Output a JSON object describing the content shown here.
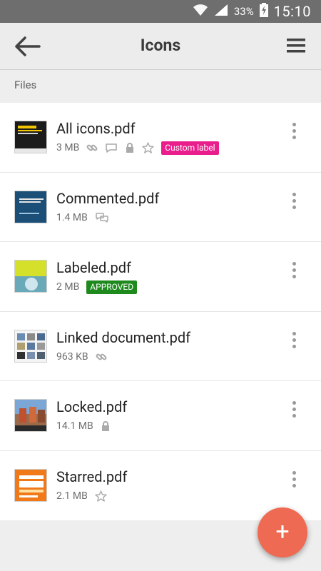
{
  "status_bar": {
    "battery_percent": "33%",
    "time": "15:10"
  },
  "app_bar": {
    "title": "Icons",
    "back_icon": "arrow-left-icon",
    "menu_icon": "hamburger-menu-icon"
  },
  "section": {
    "label": "Files"
  },
  "files": [
    {
      "name": "All icons.pdf",
      "size": "3 MB",
      "icons": [
        "link-icon",
        "comment-icon",
        "lock-icon",
        "star-icon"
      ],
      "label": {
        "text": "Custom label",
        "color": "#e91e8c"
      }
    },
    {
      "name": "Commented.pdf",
      "size": "1.4 MB",
      "icons": [
        "comment-icon"
      ]
    },
    {
      "name": "Labeled.pdf",
      "size": "2 MB",
      "icons": [],
      "label": {
        "text": "APPROVED",
        "color": "#1e8a1e"
      }
    },
    {
      "name": "Linked document.pdf",
      "size": "963 KB",
      "icons": [
        "link-icon"
      ]
    },
    {
      "name": "Locked.pdf",
      "size": "14.1 MB",
      "icons": [
        "lock-icon"
      ]
    },
    {
      "name": "Starred.pdf",
      "size": "2.1 MB",
      "icons": [
        "star-icon"
      ]
    }
  ],
  "fab": {
    "label": "+",
    "color": "#ef6a52"
  }
}
